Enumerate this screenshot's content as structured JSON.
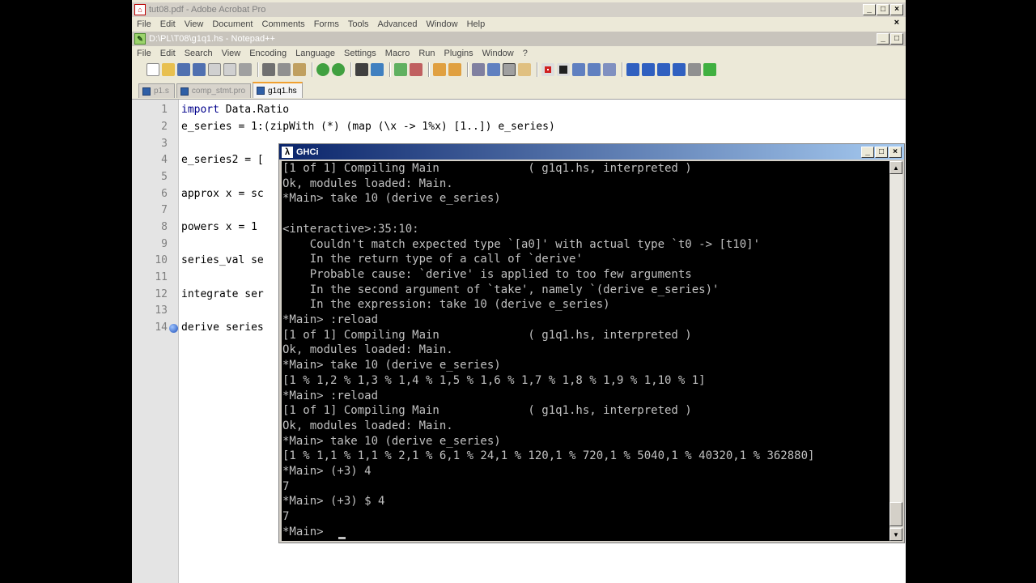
{
  "acrobat": {
    "title": "tut08.pdf - Adobe Acrobat Pro",
    "menu": [
      "File",
      "Edit",
      "View",
      "Document",
      "Comments",
      "Forms",
      "Tools",
      "Advanced",
      "Window",
      "Help"
    ],
    "close_x": "×"
  },
  "window_buttons": {
    "min": "_",
    "max": "□",
    "close": "×"
  },
  "notepadpp": {
    "title": "D:\\PL\\T08\\g1q1.hs - Notepad++",
    "menu": [
      "File",
      "Edit",
      "Search",
      "View",
      "Encoding",
      "Language",
      "Settings",
      "Macro",
      "Run",
      "Plugins",
      "Window",
      "?"
    ],
    "tabs": [
      {
        "label": "p1.s",
        "active": false
      },
      {
        "label": "comp_stmt.pro",
        "active": false
      },
      {
        "label": "g1q1.hs",
        "active": true
      }
    ],
    "line_numbers": [
      "1",
      "2",
      "3",
      "4",
      "5",
      "6",
      "7",
      "8",
      "9",
      "10",
      "11",
      "12",
      "13",
      "14"
    ],
    "code_lines": [
      {
        "kw": "import",
        "rest": " Data.Ratio"
      },
      {
        "kw": "",
        "rest": "e_series = 1:(zipWith (*) (map (\\x -> 1%x) [1..]) e_series)"
      },
      {
        "kw": "",
        "rest": ""
      },
      {
        "kw": "",
        "rest": "e_series2 = ["
      },
      {
        "kw": "",
        "rest": ""
      },
      {
        "kw": "",
        "rest": "approx x = sc"
      },
      {
        "kw": "",
        "rest": ""
      },
      {
        "kw": "",
        "rest": "powers x = 1"
      },
      {
        "kw": "",
        "rest": ""
      },
      {
        "kw": "",
        "rest": "series_val se"
      },
      {
        "kw": "",
        "rest": ""
      },
      {
        "kw": "",
        "rest": "integrate ser"
      },
      {
        "kw": "",
        "rest": ""
      },
      {
        "kw": "",
        "rest": "derive series"
      }
    ]
  },
  "ghci": {
    "title": "GHCi",
    "icon": "λ",
    "lines": [
      "[1 of 1] Compiling Main             ( g1q1.hs, interpreted )",
      "Ok, modules loaded: Main.",
      "*Main> take 10 (derive e_series)",
      "",
      "<interactive>:35:10:",
      "    Couldn't match expected type `[a0]' with actual type `t0 -> [t10]'",
      "    In the return type of a call of `derive'",
      "    Probable cause: `derive' is applied to too few arguments",
      "    In the second argument of `take', namely `(derive e_series)'",
      "    In the expression: take 10 (derive e_series)",
      "*Main> :reload",
      "[1 of 1] Compiling Main             ( g1q1.hs, interpreted )",
      "Ok, modules loaded: Main.",
      "*Main> take 10 (derive e_series)",
      "[1 % 1,2 % 1,3 % 1,4 % 1,5 % 1,6 % 1,7 % 1,8 % 1,9 % 1,10 % 1]",
      "*Main> :reload",
      "[1 of 1] Compiling Main             ( g1q1.hs, interpreted )",
      "Ok, modules loaded: Main.",
      "*Main> take 10 (derive e_series)",
      "[1 % 1,1 % 1,1 % 2,1 % 6,1 % 24,1 % 120,1 % 720,1 % 5040,1 % 40320,1 % 362880]",
      "*Main> (+3) 4",
      "7",
      "*Main> (+3) $ 4",
      "7",
      "*Main> "
    ],
    "scroll_up": "▲",
    "scroll_down": "▼"
  }
}
